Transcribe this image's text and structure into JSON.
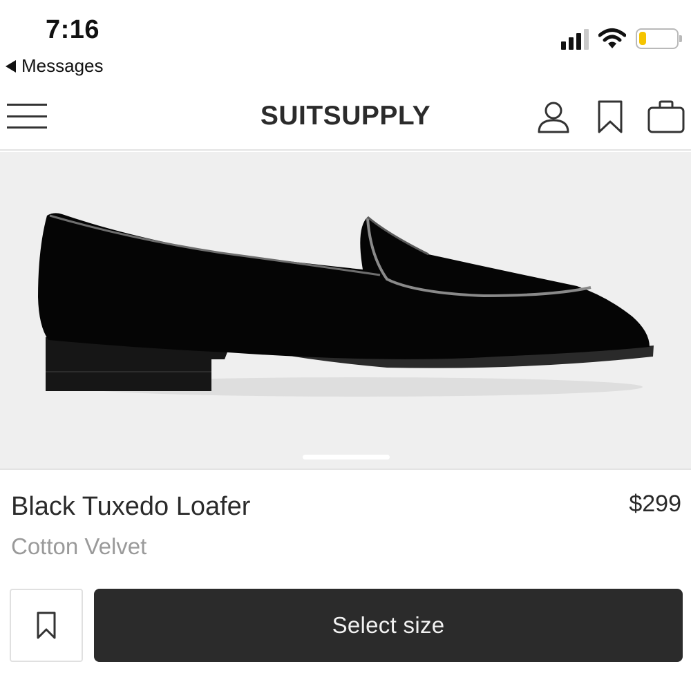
{
  "status_bar": {
    "time": "7:16",
    "back_label": "Messages",
    "signal_bars": 3,
    "signal_bars_total": 4,
    "battery_level": 0.2,
    "battery_color": "#f5c400"
  },
  "header": {
    "brand": "SUITSUPPLY",
    "icons": [
      "menu-icon",
      "account-icon",
      "bookmark-icon",
      "shopping-bag-icon"
    ]
  },
  "product": {
    "image_subject": "shoe-icon",
    "carousel_slides_visible": 1,
    "name": "Black Tuxedo Loafer",
    "price": "$299",
    "material": "Cotton Velvet"
  },
  "actions": {
    "wishlist_icon": "bookmark-icon",
    "select_size_label": "Select size",
    "button_color": "#2b2b2b"
  }
}
